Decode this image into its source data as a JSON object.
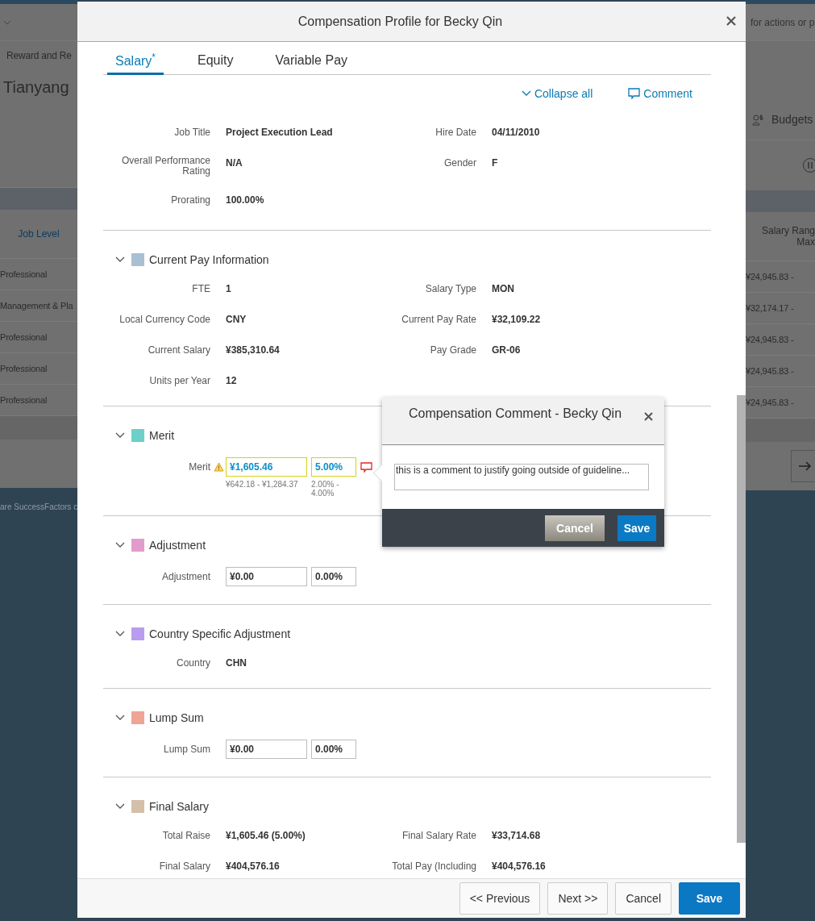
{
  "background": {
    "left": {
      "breadcrumb": "Reward and Re",
      "employee_name": "Tianyang",
      "column_header": "Job Level",
      "rows": [
        "Professional",
        "Management & Pla",
        "Professional",
        "Professional",
        "Professional"
      ],
      "footer_text": "are SuccessFactors c"
    },
    "right": {
      "search_hint": "for actions or p",
      "budgets": "Budgets",
      "column_header": [
        "Salary Rang",
        "Max"
      ],
      "rows": [
        "¥24,945.83 -",
        "¥32,174.17 -",
        "¥24,945.83 -",
        "¥24,945.83 -",
        "¥24,945.83 -"
      ]
    }
  },
  "dialog": {
    "title": "Compensation Profile for Becky Qin",
    "tabs": [
      {
        "label": "Salary$^{*}$",
        "selected": true
      },
      {
        "label": "Equity",
        "selected": false
      },
      {
        "label": "Variable Pay",
        "selected": false
      }
    ],
    "collapse_all": "Collapse all",
    "comment": "Comment",
    "summary": [
      {
        "label": "Job Title",
        "value": "Project Execution Lead"
      },
      {
        "label": "Hire Date",
        "value": "04/11/2010"
      },
      {
        "label": "Overall Performance Rating",
        "value": "N/A"
      },
      {
        "label": "Gender",
        "value": "F"
      },
      {
        "label": "Prorating",
        "value": "100.00%"
      }
    ],
    "sections": [
      {
        "title": "Current Pay Information",
        "color": "#a9c0d3",
        "fields": [
          {
            "kind": "text",
            "label": "FTE",
            "value": "1"
          },
          {
            "kind": "text",
            "label": "Salary Type",
            "value": "MON"
          },
          {
            "kind": "text",
            "label": "Local Currency Code",
            "value": "CNY"
          },
          {
            "kind": "text",
            "label": "Current Pay Rate",
            "value": "¥32,109.22"
          },
          {
            "kind": "text",
            "label": "Current Salary",
            "value": "¥385,310.64"
          },
          {
            "kind": "text",
            "label": "Pay Grade",
            "value": "GR-06"
          },
          {
            "kind": "text",
            "label": "Units per Year",
            "value": "12"
          }
        ]
      },
      {
        "title": "Merit",
        "color": "#6ccfc8",
        "fields": [
          {
            "kind": "amount",
            "label": "Merit",
            "amount": "¥1,605.46",
            "percent": "5.00%",
            "amount_range": "¥642.18 - ¥1,284.37",
            "percent_range": "2.00% - 4.00%",
            "warning": true,
            "has_comment": true
          }
        ]
      },
      {
        "title": "Adjustment",
        "color": "#e29ccb",
        "fields": [
          {
            "kind": "amount",
            "label": "Adjustment",
            "amount": "¥0.00",
            "percent": "0.00%",
            "warning": false,
            "has_comment": false
          }
        ]
      },
      {
        "title": "Country Specific Adjustment",
        "color": "#b99cf0",
        "fields": [
          {
            "kind": "text",
            "label": "Country",
            "value": "CHN"
          }
        ]
      },
      {
        "title": "Lump Sum",
        "color": "#f0a494",
        "fields": [
          {
            "kind": "amount",
            "label": "Lump Sum",
            "amount": "¥0.00",
            "percent": "0.00%",
            "warning": false,
            "has_comment": false
          }
        ]
      },
      {
        "title": "Final Salary",
        "color": "#d4c0a8",
        "fields": [
          {
            "kind": "text",
            "label": "Total Raise",
            "value": "¥1,605.46 (5.00%)"
          },
          {
            "kind": "text",
            "label": "Final Salary Rate",
            "value": "¥33,714.68"
          },
          {
            "kind": "text",
            "label": "Final Salary",
            "value": "¥404,576.16"
          },
          {
            "kind": "text",
            "label": "Total Pay (Including",
            "value": "¥404,576.16"
          }
        ]
      }
    ],
    "buttons": [
      {
        "label": "<< Previous",
        "kind": "secondary"
      },
      {
        "label": "Next >>",
        "kind": "secondary"
      },
      {
        "label": "Cancel",
        "kind": "secondary"
      },
      {
        "label": "Save",
        "kind": "primary"
      }
    ]
  },
  "comment_popup": {
    "title": "Compensation Comment - Becky Qin",
    "comment_text": "this is a comment to justify going outside of guideline...",
    "buttons": [
      {
        "label": "Cancel",
        "kind": "secondary"
      },
      {
        "label": "Save",
        "kind": "primary"
      }
    ]
  }
}
